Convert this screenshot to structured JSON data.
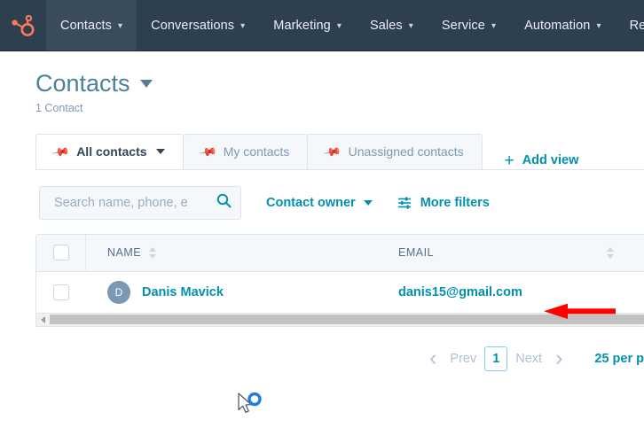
{
  "nav": {
    "logo_icon": "hubspot-sprocket-logo",
    "items": [
      {
        "label": "Contacts",
        "active": true
      },
      {
        "label": "Conversations",
        "active": false
      },
      {
        "label": "Marketing",
        "active": false
      },
      {
        "label": "Sales",
        "active": false
      },
      {
        "label": "Service",
        "active": false
      },
      {
        "label": "Automation",
        "active": false
      },
      {
        "label": "Reports",
        "active": false
      }
    ]
  },
  "header": {
    "title": "Contacts",
    "subtitle": "1 Contact"
  },
  "tabs": {
    "items": [
      {
        "label": "All contacts",
        "active": true
      },
      {
        "label": "My contacts",
        "active": false
      },
      {
        "label": "Unassigned contacts",
        "active": false
      }
    ],
    "add_view_label": "Add view",
    "add_view_plus": "+"
  },
  "filters": {
    "search_placeholder": "Search name, phone, e",
    "search_value": "",
    "contact_owner_label": "Contact owner",
    "more_filters_label": "More filters"
  },
  "table": {
    "columns": [
      {
        "label": "NAME"
      },
      {
        "label": "EMAIL"
      }
    ],
    "rows": [
      {
        "avatar_initial": "D",
        "name": "Danis Mavick",
        "email": "danis15@gmail.com"
      }
    ]
  },
  "pagination": {
    "prev_label": "Prev",
    "page_label": "1",
    "next_label": "Next",
    "per_page_label": "25 per p"
  },
  "annotations": {
    "arrow_color": "#ff0000",
    "cursor_state": "busy-spinner"
  },
  "colors": {
    "nav_bg": "#2e3f50",
    "nav_active_bg": "#3a4b5c",
    "brand_orange": "#ff7a59",
    "link_teal": "#0091ae",
    "title_teal": "#4a8299",
    "muted": "#7c98b6",
    "border": "#dfe3eb",
    "panel_bg": "#f5f8fa"
  }
}
